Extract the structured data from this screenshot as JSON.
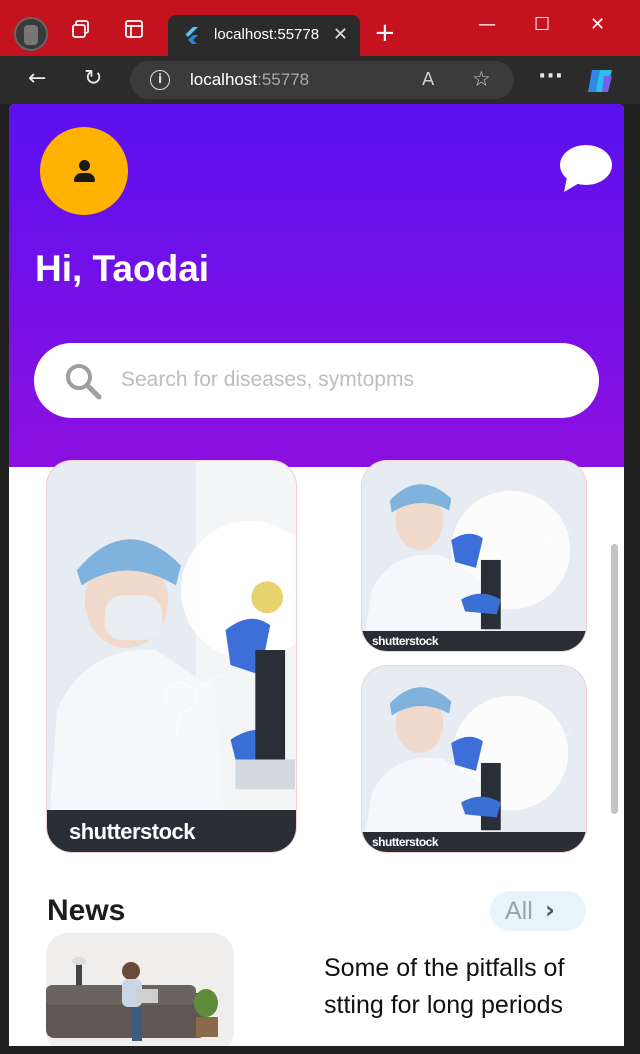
{
  "browser": {
    "tab_title": "localhost:55778",
    "url_host": "localhost",
    "url_port": ":55778",
    "icons": {
      "profile": "profile-icon",
      "workspaces": "workspaces-icon",
      "tab_actions": "tab-actions-icon",
      "new_tab": "+",
      "close_tab": "✕",
      "minimize": "—",
      "maximize": "☐",
      "close_window": "✕",
      "back": "←",
      "refresh": "↻",
      "read_aloud": "A",
      "favorite": "☆",
      "more": "···",
      "copilot": "copilot-icon"
    }
  },
  "app": {
    "greeting": "Hi, Taodai",
    "search": {
      "placeholder": "Search for diseases, symtopms"
    },
    "banners": [
      {
        "watermark": "shutterstock"
      },
      {
        "watermark": "shutterstock"
      },
      {
        "watermark": "shutterstock"
      }
    ],
    "news": {
      "section_title": "News",
      "all_label": "All",
      "items": [
        {
          "headline": "Some of the pitfalls of stting for long periods"
        }
      ]
    }
  },
  "colors": {
    "header_top": "#5b10f0",
    "header_bottom": "#8c10e0",
    "avatar": "#ffb300",
    "titlebar": "#c4121f"
  }
}
